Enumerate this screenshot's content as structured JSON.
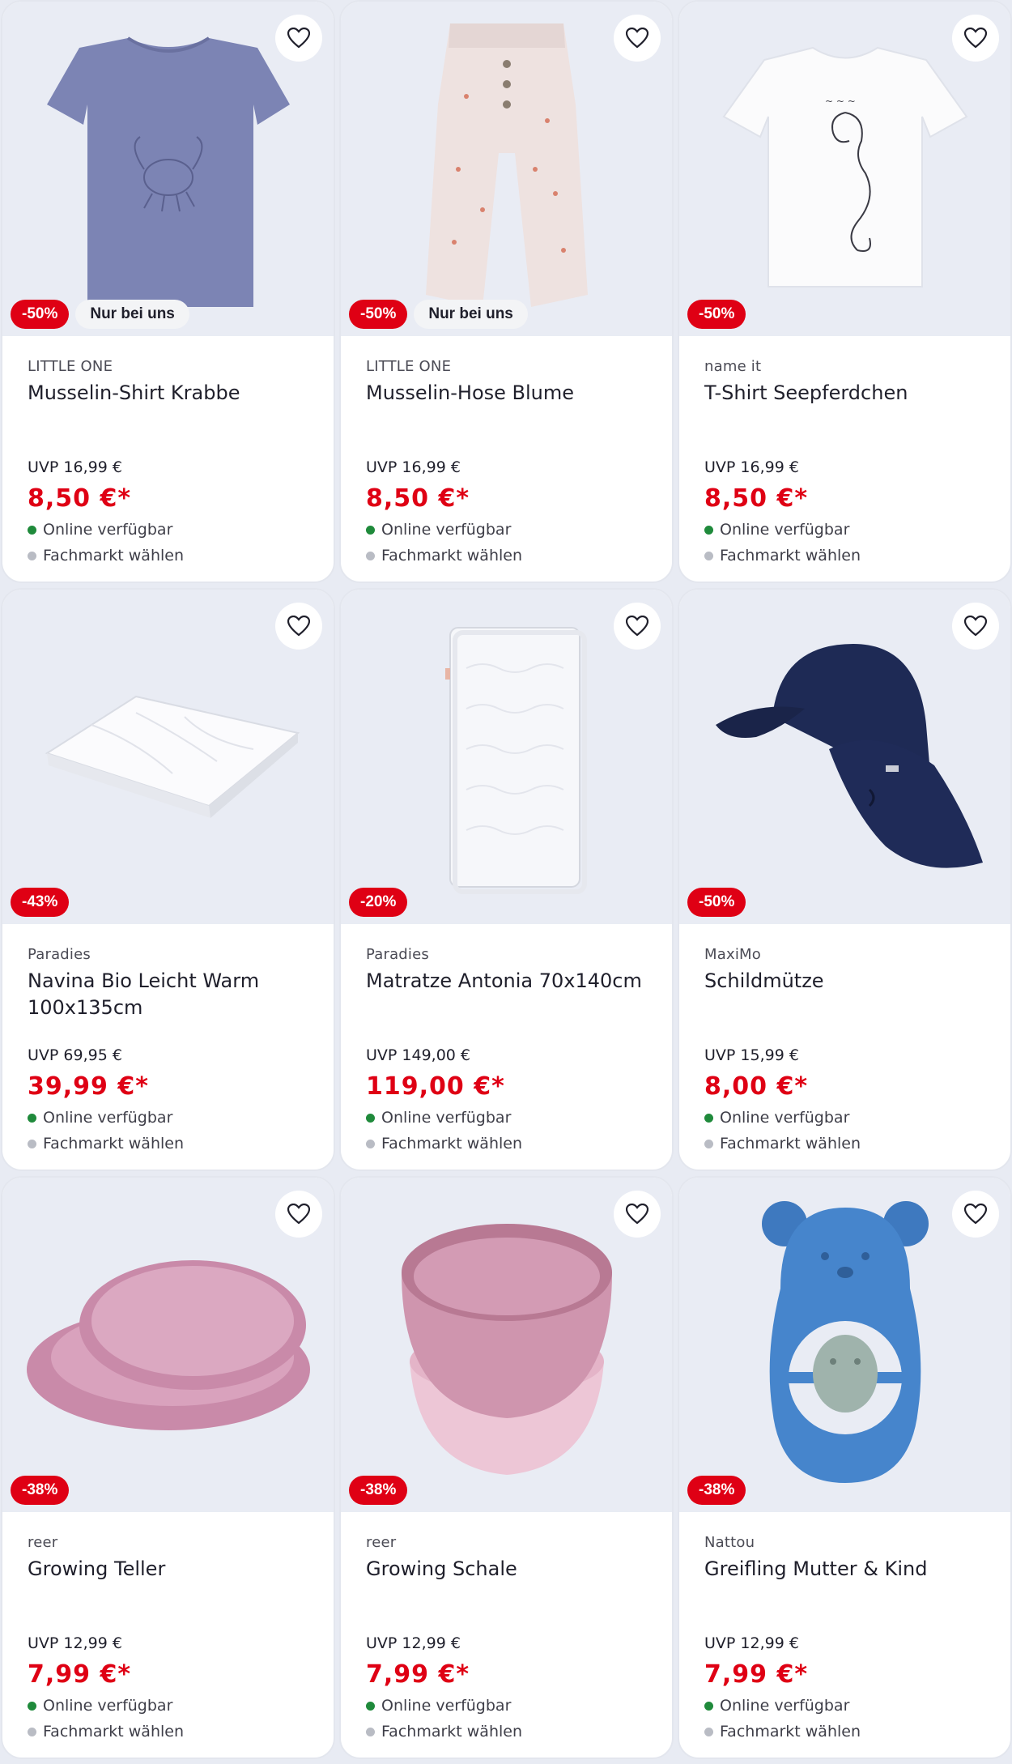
{
  "colors": {
    "sale": "#df0014",
    "available": "#1f8a3b",
    "store": "#b9bcc4",
    "card_bg": "#ffffff",
    "image_bg": "#e9ecf4"
  },
  "labels": {
    "available": "Online verfügbar",
    "store": "Fachmarkt wählen",
    "favorite_icon": "heart-outline-icon"
  },
  "products": [
    {
      "brand": "LITTLE ONE",
      "title": "Musselin-Shirt Krabbe",
      "uvp": "UVP 16,99 €",
      "price": "8,50 €*",
      "discount": "-50%",
      "exclusive": "Nur bei uns",
      "image": "shirt-crab"
    },
    {
      "brand": "LITTLE ONE",
      "title": "Musselin-Hose Blume",
      "uvp": "UVP 16,99 €",
      "price": "8,50 €*",
      "discount": "-50%",
      "exclusive": "Nur bei uns",
      "image": "pants-flower"
    },
    {
      "brand": "name it",
      "title": "T-Shirt Seepferdchen",
      "uvp": "UVP 16,99 €",
      "price": "8,50 €*",
      "discount": "-50%",
      "exclusive": "",
      "image": "tshirt-seahorse"
    },
    {
      "brand": "Paradies",
      "title": "Navina Bio Leicht Warm 100x135cm",
      "uvp": "UVP 69,95 €",
      "price": "39,99 €*",
      "discount": "-43%",
      "exclusive": "",
      "image": "blanket"
    },
    {
      "brand": "Paradies",
      "title": "Matratze Antonia 70x140cm",
      "uvp": "UVP 149,00 €",
      "price": "119,00 €*",
      "discount": "-20%",
      "exclusive": "",
      "image": "mattress"
    },
    {
      "brand": "MaxiMo",
      "title": "Schildmütze",
      "uvp": "UVP 15,99 €",
      "price": "8,00 €*",
      "discount": "-50%",
      "exclusive": "",
      "image": "sun-hat"
    },
    {
      "brand": "reer",
      "title": "Growing Teller",
      "uvp": "UVP 12,99 €",
      "price": "7,99 €*",
      "discount": "-38%",
      "exclusive": "",
      "image": "plates"
    },
    {
      "brand": "reer",
      "title": "Growing Schale",
      "uvp": "UVP 12,99 €",
      "price": "7,99 €*",
      "discount": "-38%",
      "exclusive": "",
      "image": "bowls"
    },
    {
      "brand": "Nattou",
      "title": "Greifling Mutter & Kind",
      "uvp": "UVP 12,99 €",
      "price": "7,99 €*",
      "discount": "-38%",
      "exclusive": "",
      "image": "teether-bear"
    }
  ]
}
